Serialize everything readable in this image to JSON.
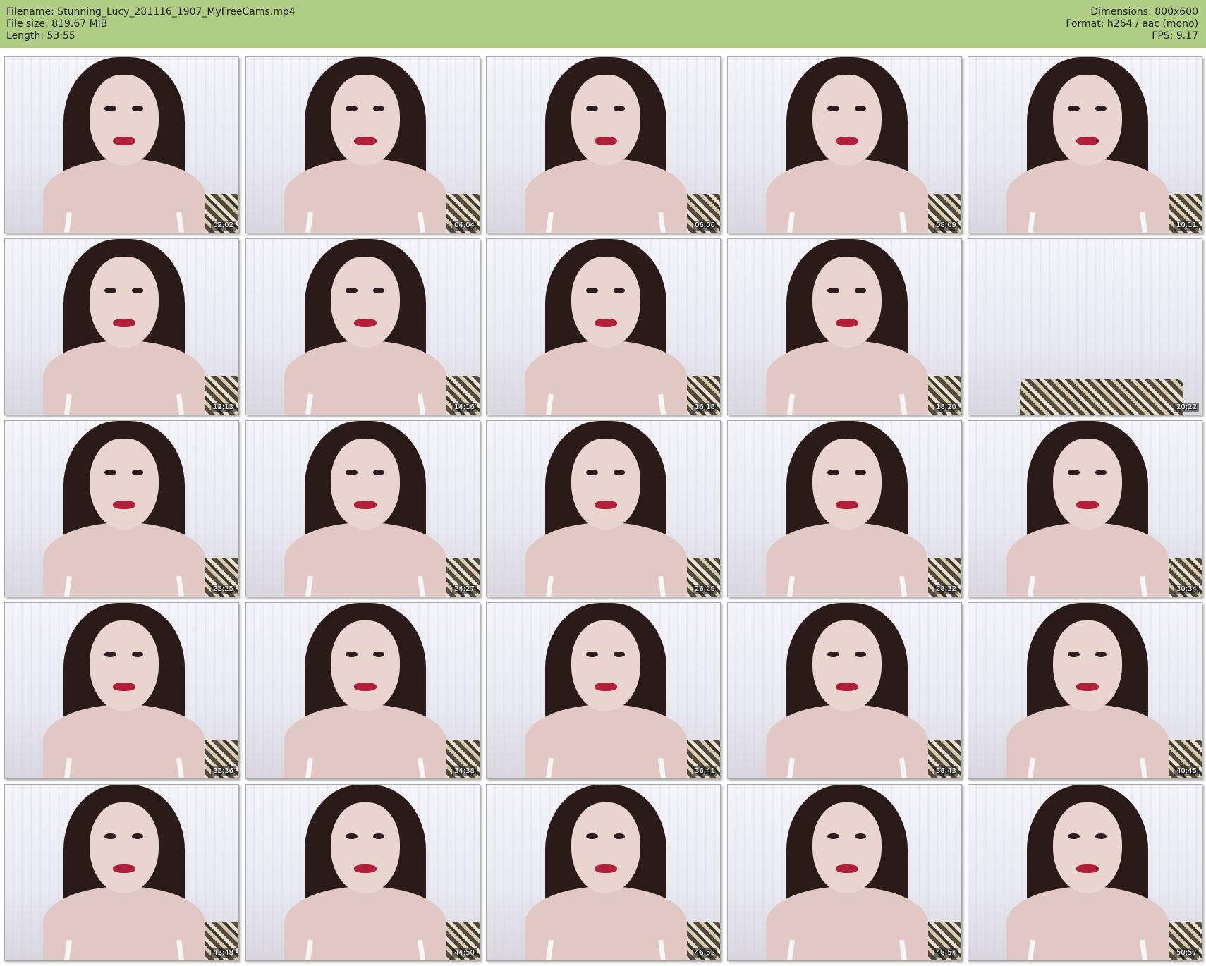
{
  "header": {
    "filename": "Filename: Stunning_Lucy_281116_1907_MyFreeCams.mp4",
    "file_size": "File size: 819.67 MiB",
    "length": "Length: 53:55",
    "dimensions": "Dimensions: 800x600",
    "format": "Format: h264 / aac (mono)",
    "fps": "FPS: 9.17",
    "background_color": "#b0cd86"
  },
  "thumbnails": [
    {
      "timestamp": "02:02"
    },
    {
      "timestamp": "04:04"
    },
    {
      "timestamp": "06:06"
    },
    {
      "timestamp": "08:09"
    },
    {
      "timestamp": "10:11"
    },
    {
      "timestamp": "12:13"
    },
    {
      "timestamp": "14:16"
    },
    {
      "timestamp": "16:18"
    },
    {
      "timestamp": "18:20"
    },
    {
      "timestamp": "20:22"
    },
    {
      "timestamp": "22:25"
    },
    {
      "timestamp": "24:27"
    },
    {
      "timestamp": "26:29"
    },
    {
      "timestamp": "28:32"
    },
    {
      "timestamp": "30:34"
    },
    {
      "timestamp": "32:36"
    },
    {
      "timestamp": "34:38"
    },
    {
      "timestamp": "36:41"
    },
    {
      "timestamp": "38:43"
    },
    {
      "timestamp": "40:45"
    },
    {
      "timestamp": "42:48"
    },
    {
      "timestamp": "44:50"
    },
    {
      "timestamp": "46:52"
    },
    {
      "timestamp": "48:54"
    },
    {
      "timestamp": "50:57"
    }
  ]
}
